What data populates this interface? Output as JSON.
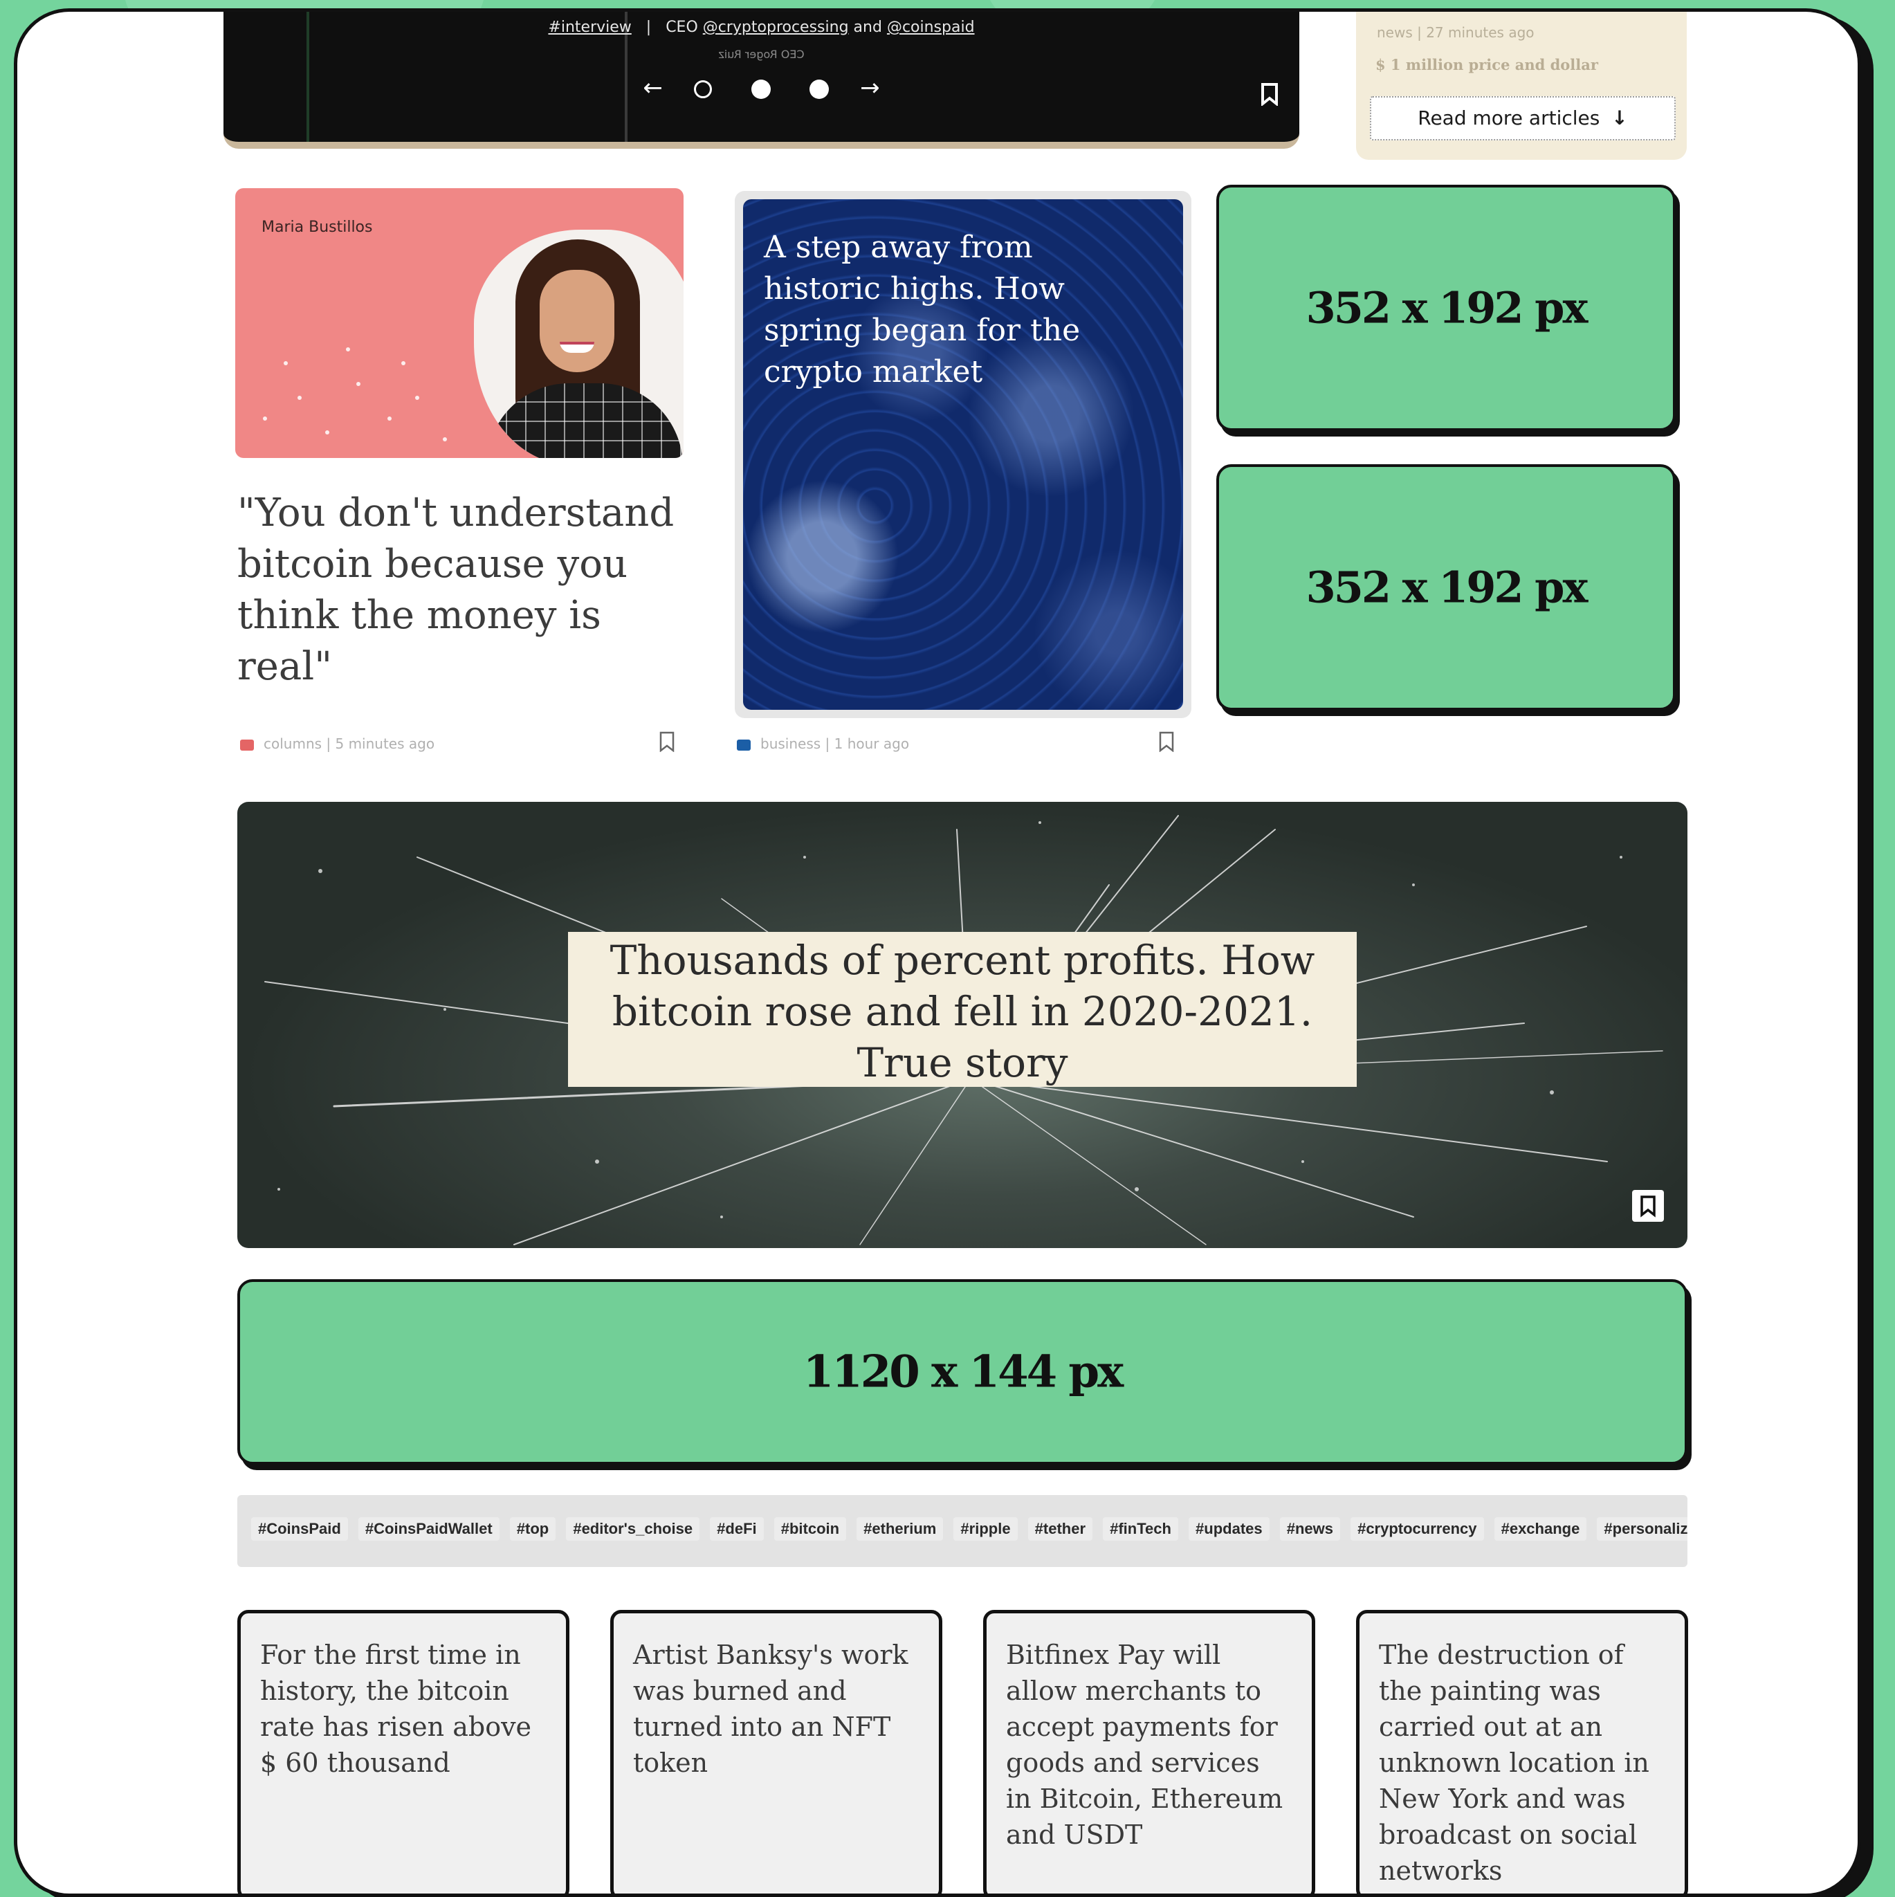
{
  "hero": {
    "caption_tag": "#interview",
    "caption_sep": "|",
    "caption_ceo": "CEO",
    "caption_link1": "@cryptoprocessing",
    "caption_and": "and",
    "caption_link2": "@coinspaid",
    "mirrored_text": "CEO Roger Ruiz",
    "nav_prev": "←",
    "nav_next": "→"
  },
  "side_news": {
    "meta": "news | 27 minutes ago",
    "teaser": "$ 1 million price and dollar",
    "read_more_label": "Read more articles",
    "read_more_icon": "↓"
  },
  "card_columns": {
    "author": "Maria Bustillos",
    "title": "\"You don't understand bitcoin because you think the money is real\"",
    "meta": "columns | 5 minutes ago",
    "category_color": "#e46565"
  },
  "card_business": {
    "title": "A step away from historic highs. How spring began for the crypto market",
    "meta": "business | 1 hour ago",
    "category_color": "#1b5ea6"
  },
  "ads": {
    "side_top": "352 x 192 px",
    "side_bottom": "352 x 192 px",
    "wide": "1120 x 144 px"
  },
  "banner": {
    "title_line1": "Thousands of percent profits. How",
    "title_line2": "bitcoin rose and fell in 2020-2021.",
    "title_line3": "True story"
  },
  "tags": [
    "#CoinsPaid",
    "#CoinsPaidWallet",
    "#top",
    "#editor's_choise",
    "#deFi",
    "#bitcoin",
    "#etherium",
    "#ripple",
    "#tether",
    "#finTech",
    "#updates",
    "#news",
    "#cryptocurrency",
    "#exchange",
    "#personaliz"
  ],
  "news_cards": [
    "For the first time in history, the bitcoin rate has risen above $ 60 thousand",
    "Artist Banksy's work was burned and turned into an NFT token",
    "Bitfinex Pay will allow merchants to accept payments for goods and services in Bitcoin, Ethereum and USDT",
    "The destruction of the painting was carried out at an unknown location in New York and was broadcast on social networks"
  ],
  "colors": {
    "background_green": "#74d49d",
    "ad_green": "#72cf97",
    "beige": "#f3ecd9"
  }
}
